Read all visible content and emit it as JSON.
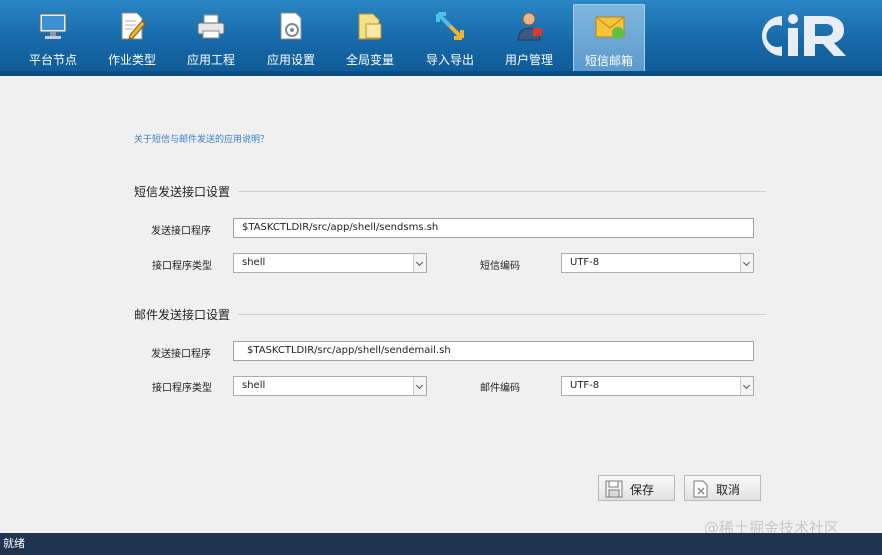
{
  "toolbar": {
    "items": [
      {
        "label": "平台节点",
        "icon": "computer-icon"
      },
      {
        "label": "作业类型",
        "icon": "edit-document-icon"
      },
      {
        "label": "应用工程",
        "icon": "printer-icon"
      },
      {
        "label": "应用设置",
        "icon": "settings-document-icon"
      },
      {
        "label": "全局变量",
        "icon": "folder-document-icon"
      },
      {
        "label": "导入导出",
        "icon": "import-export-arrows-icon"
      },
      {
        "label": "用户管理",
        "icon": "user-manager-icon"
      },
      {
        "label": "短信邮箱",
        "icon": "envelope-icon",
        "active": true
      }
    ],
    "logo": "CiR"
  },
  "help_link": "关于短信与邮件发送的应用说明？",
  "sms": {
    "title": "短信发送接口设置",
    "program_label": "发送接口程序",
    "program_value": "$TASKCTLDIR/src/app/shell/sendsms.sh",
    "type_label": "接口程序类型",
    "type_value": "shell",
    "encoding_label": "短信编码",
    "encoding_value": "UTF-8"
  },
  "mail": {
    "title": "邮件发送接口设置",
    "program_label": "发送接口程序",
    "program_value": "$TASKCTLDIR/src/app/shell/sendemail.sh",
    "type_label": "接口程序类型",
    "type_value": "shell",
    "encoding_label": "邮件编码",
    "encoding_value": "UTF-8"
  },
  "buttons": {
    "save": "保存",
    "cancel": "取消"
  },
  "status": "就绪",
  "watermark": "@稀土掘金技术社区",
  "colors": {
    "toolbar": "#1769a8",
    "status_bar": "#1f3450",
    "link": "#3a7fc0"
  }
}
